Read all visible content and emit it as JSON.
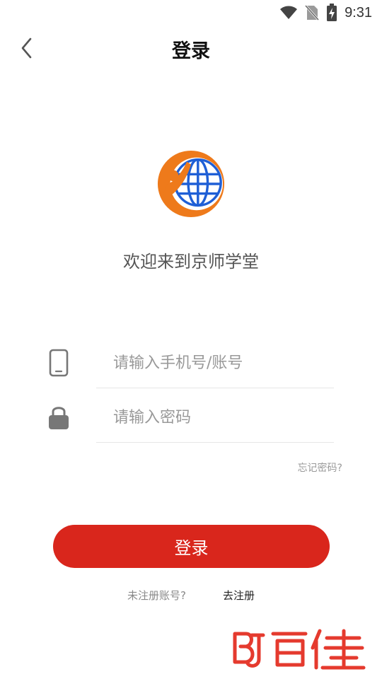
{
  "status_bar": {
    "time": "9:31",
    "icons": [
      "wifi-icon",
      "no-sim-icon",
      "battery-charging-icon"
    ]
  },
  "header": {
    "title": "登录",
    "back_icon": "chevron-left-icon"
  },
  "logo": {
    "icon": "app-logo-globe",
    "colors": {
      "orange": "#ee7a1b",
      "blue": "#1f5fd6"
    }
  },
  "welcome_text": "欢迎来到京师学堂",
  "form": {
    "phone_placeholder": "请输入手机号/账号",
    "phone_value": "",
    "password_placeholder": "请输入密码",
    "password_value": "",
    "forgot_label": "忘记密码?"
  },
  "login_button": {
    "label": "登录",
    "color": "#d9261c"
  },
  "register": {
    "prompt": "未注册账号?",
    "link": "去注册"
  },
  "watermark": {
    "text": "BJ百佳",
    "color": "#e53a2e"
  }
}
